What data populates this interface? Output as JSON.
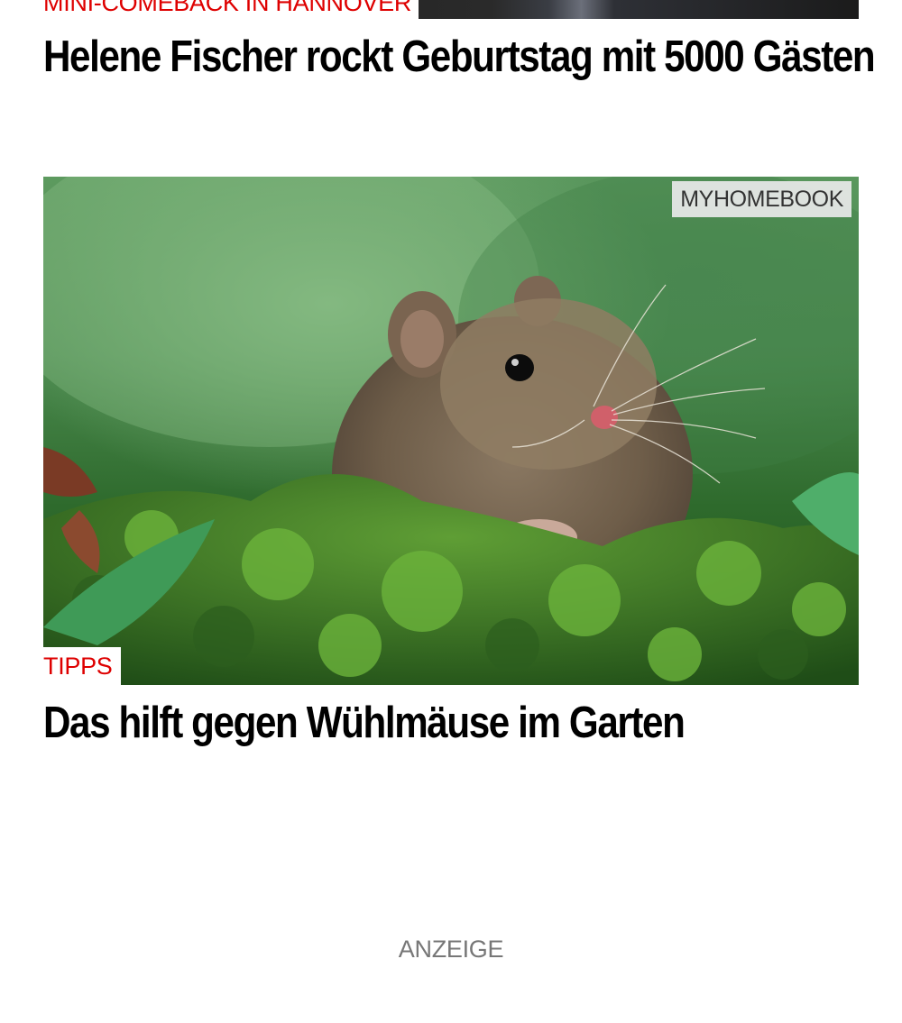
{
  "teasers": [
    {
      "kicker": "MINI-COMEBACK IN HANNOVER",
      "headline": "Helene Fischer rockt Geburtstag mit 5000 Gästen",
      "image_alt": "teaser photo (dark, cut off)"
    },
    {
      "kicker": "TIPPS",
      "headline": "Das hilft gegen Wühlmäuse im Garten",
      "badge": "MYHOMEBOOK",
      "image_alt": "vole in green moss"
    }
  ],
  "ad": {
    "label": "ANZEIGE"
  },
  "colors": {
    "kicker": "#de0000",
    "headline": "#000000",
    "badge_bg": "#e8e8e8",
    "ad_label": "#777777"
  }
}
